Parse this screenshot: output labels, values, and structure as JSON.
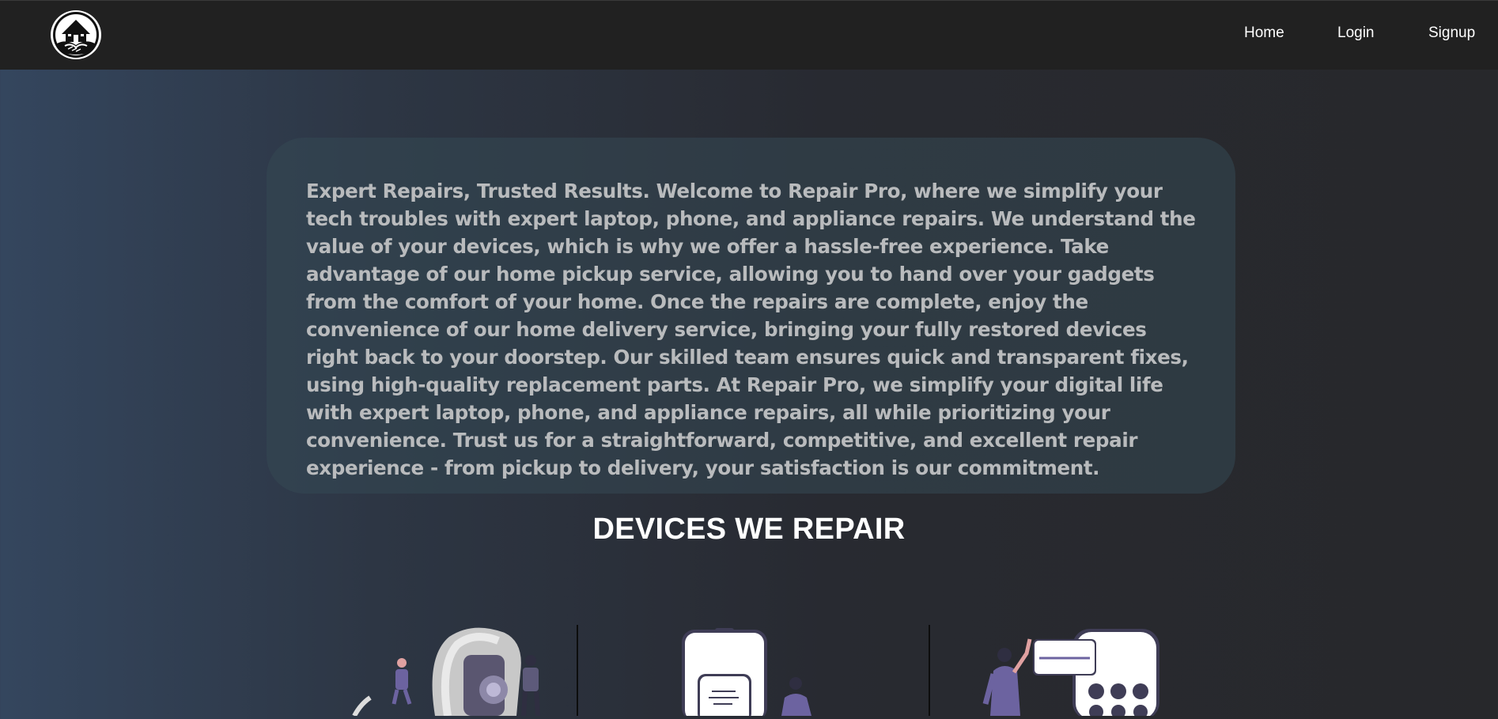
{
  "navbar": {
    "logo_alt": "Repair Pro logo",
    "links": [
      {
        "label": "Home"
      },
      {
        "label": "Login"
      },
      {
        "label": "Signup"
      }
    ]
  },
  "intro": {
    "text": "Expert Repairs, Trusted Results. Welcome to Repair Pro, where we simplify your tech troubles with expert laptop, phone, and appliance repairs. We understand the value of your devices, which is why we offer a hassle-free experience. Take advantage of our home pickup service, allowing you to hand over your gadgets from the comfort of your home. Once the repairs are complete, enjoy the convenience of our home delivery service, bringing your fully restored devices right back to your doorstep. Our skilled team ensures quick and transparent fixes, using high-quality replacement parts. At Repair Pro, we simplify your digital life with expert laptop, phone, and appliance repairs, all while prioritizing your convenience. Trust us for a straightforward, competitive, and excellent repair experience - from pickup to delivery, your satisfaction is our commitment."
  },
  "devices": {
    "title": "DEVICES WE REPAIR",
    "items": [
      {
        "icon": "smartwatch-repair-illustration"
      },
      {
        "icon": "phone-repair-illustration"
      },
      {
        "icon": "appliance-repair-illustration"
      }
    ]
  },
  "colors": {
    "navbar_bg": "#212121",
    "text_light": "#b9bbbd",
    "illustration_accent": "#6c63a0"
  }
}
